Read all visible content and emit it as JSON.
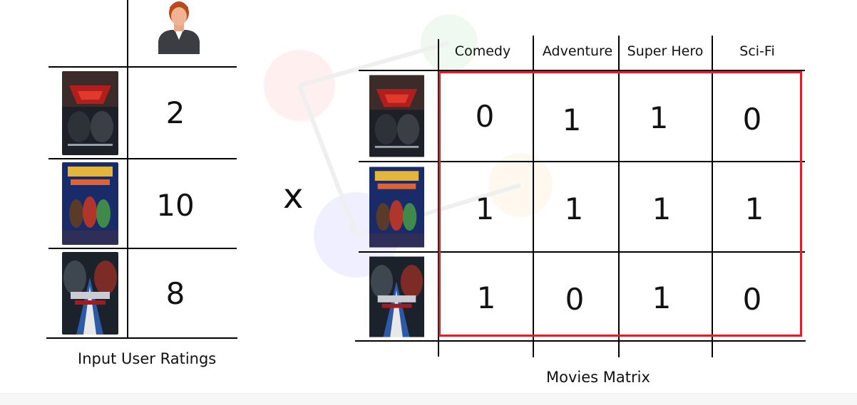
{
  "multiply_symbol": "x",
  "ratings_caption": "Input User Ratings",
  "matrix_caption": "Movies Matrix",
  "user_ratings": [
    "2",
    "10",
    "8"
  ],
  "genres": [
    "Comedy",
    "Adventure",
    "Super Hero",
    "Sci-Fi"
  ],
  "matrix": [
    [
      "0",
      "1",
      "1",
      "0"
    ],
    [
      "1",
      "1",
      "1",
      "1"
    ],
    [
      "1",
      "0",
      "1",
      "0"
    ]
  ],
  "colors": {
    "highlight": "#d8222b",
    "grid": "#000000"
  }
}
